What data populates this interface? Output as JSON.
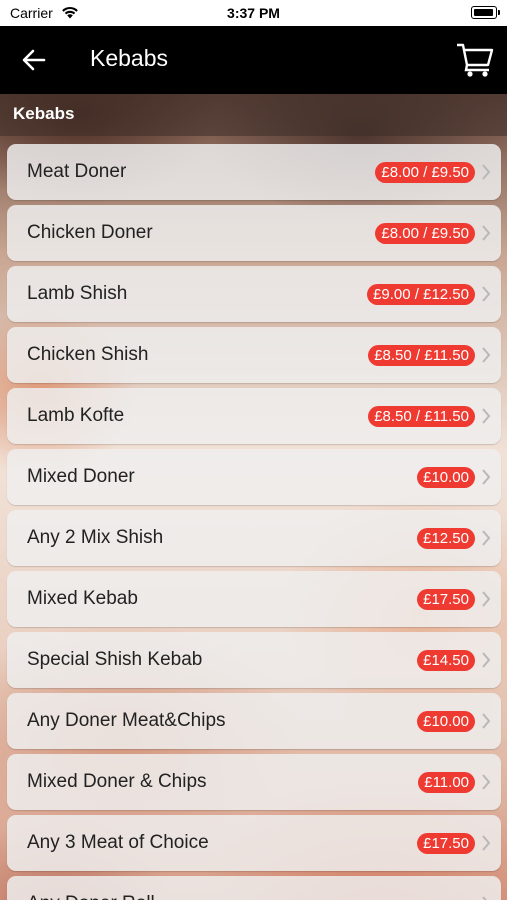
{
  "status_bar": {
    "carrier": "Carrier",
    "time": "3:37 PM"
  },
  "nav": {
    "title": "Kebabs",
    "back_icon": "back-arrow-icon",
    "cart_icon": "cart-icon"
  },
  "section": {
    "title": "Kebabs"
  },
  "colors": {
    "nav_bg": "#000000",
    "badge": "#ee3a31",
    "row_bg": "#eeeeee"
  },
  "items": [
    {
      "name": "Meat Doner",
      "price": "£8.00 / £9.50"
    },
    {
      "name": "Chicken Doner",
      "price": "£8.00 / £9.50"
    },
    {
      "name": "Lamb Shish",
      "price": "£9.00 / £12.50"
    },
    {
      "name": "Chicken Shish",
      "price": "£8.50 / £11.50"
    },
    {
      "name": "Lamb Kofte",
      "price": "£8.50 / £11.50"
    },
    {
      "name": "Mixed Doner",
      "price": "£10.00"
    },
    {
      "name": "Any 2 Mix Shish",
      "price": "£12.50"
    },
    {
      "name": "Mixed Kebab",
      "price": "£17.50"
    },
    {
      "name": "Special Shish Kebab",
      "price": "£14.50"
    },
    {
      "name": "Any Doner Meat&Chips",
      "price": "£10.00"
    },
    {
      "name": "Mixed Doner & Chips",
      "price": "£11.00"
    },
    {
      "name": "Any 3 Meat of Choice",
      "price": "£17.50"
    },
    {
      "name": "Any Doner Roll",
      "price": ""
    }
  ]
}
